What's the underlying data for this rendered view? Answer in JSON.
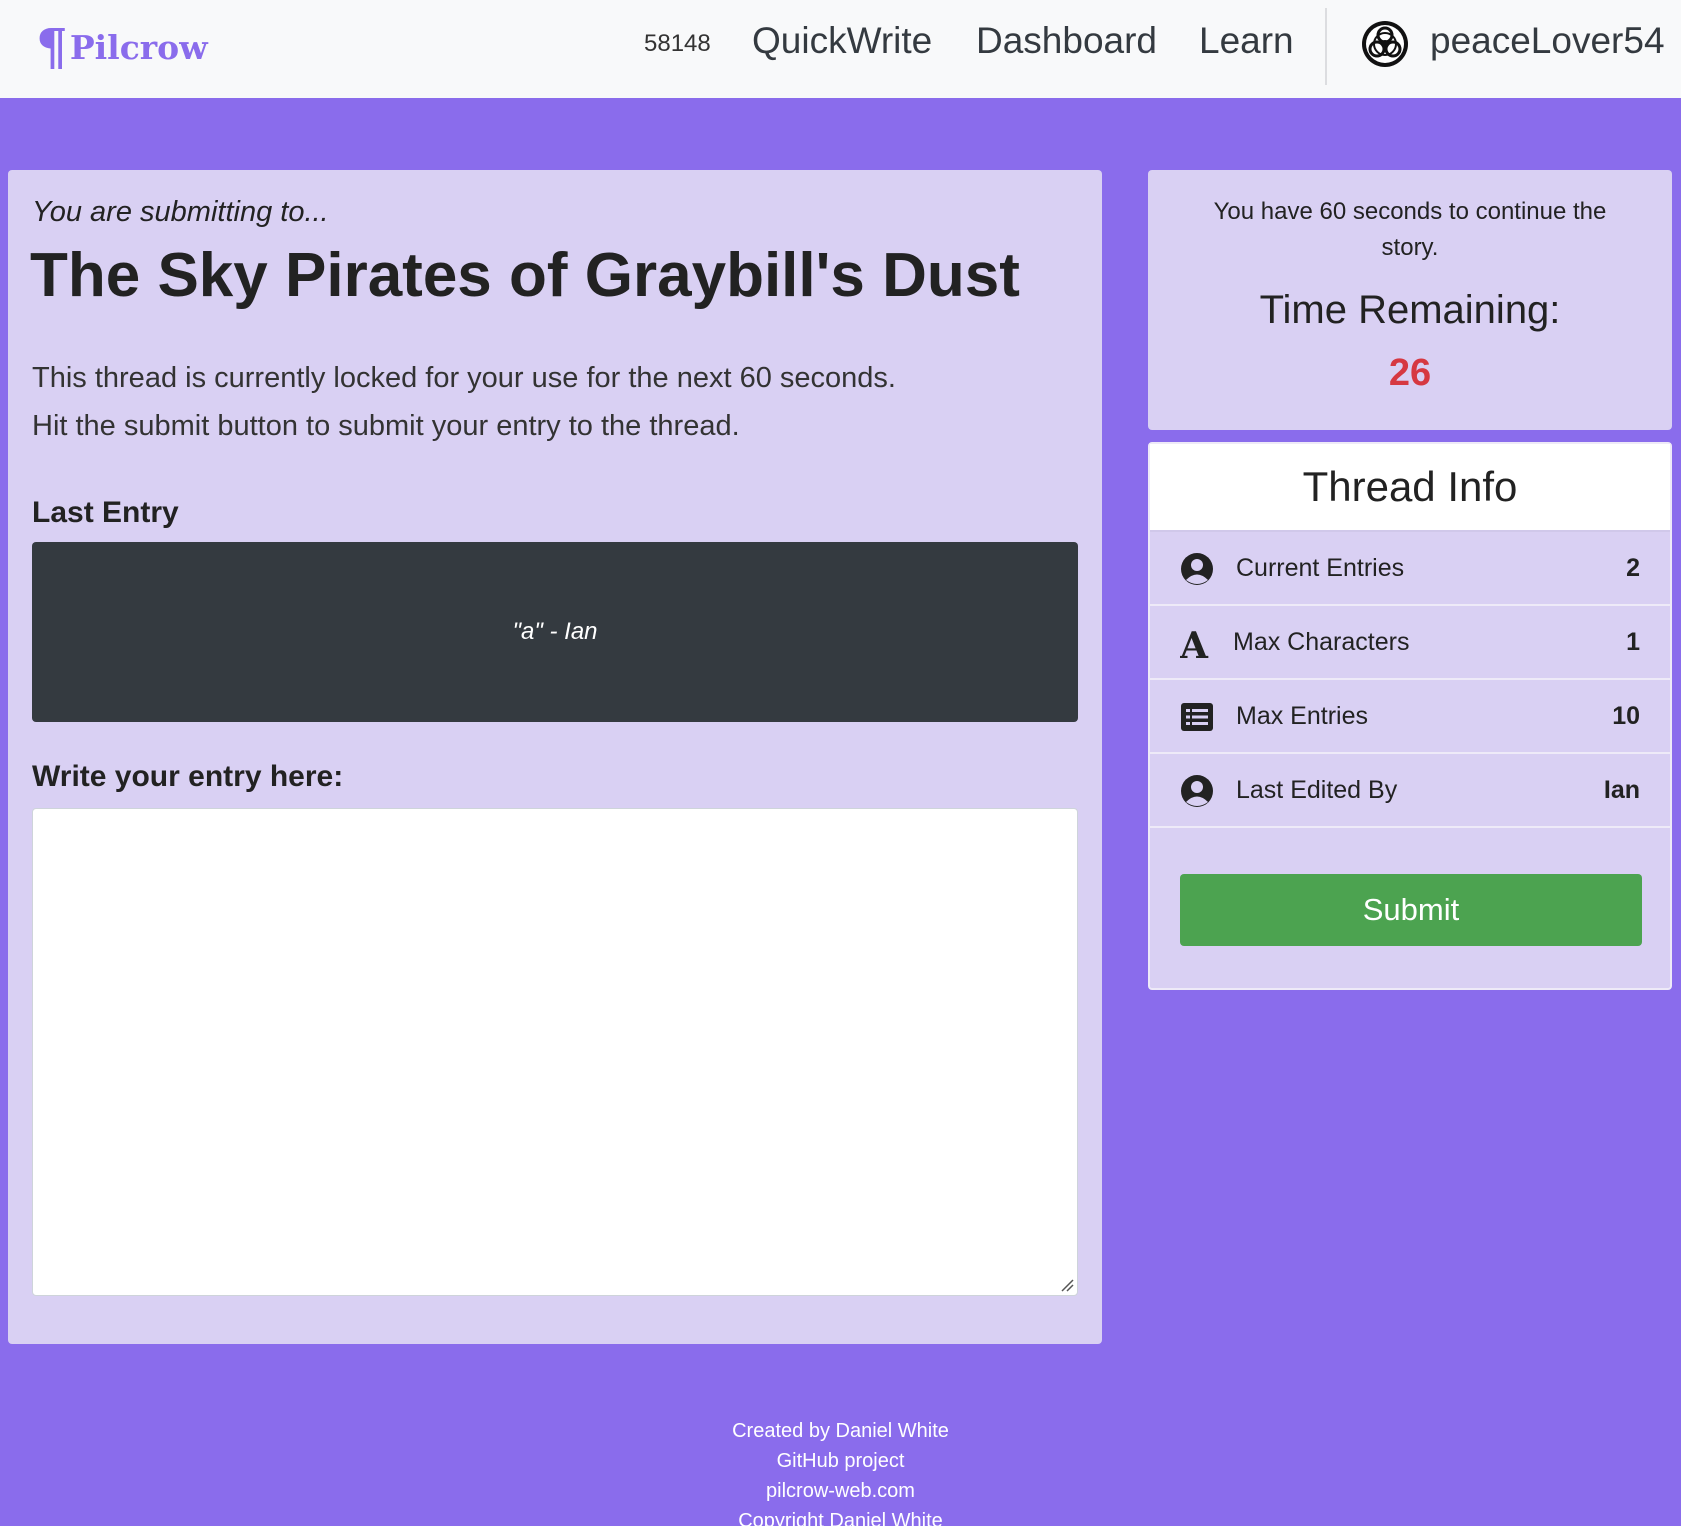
{
  "nav": {
    "brand": "Pilcrow",
    "brand_mark": "¶",
    "code": "58148",
    "links": [
      "QuickWrite",
      "Dashboard",
      "Learn"
    ],
    "username": "peaceLover54",
    "avatar_icon": "biohazard-icon"
  },
  "main": {
    "kicker": "You are submitting to...",
    "title": "The Sky Pirates of Graybill's Dust",
    "desc_line1": "This thread is currently locked for your use for the next 60 seconds.",
    "desc_line2": "Hit the submit button to submit your entry to the thread.",
    "last_entry_label": "Last Entry",
    "last_entry_text": "\"a\" - Ian",
    "write_label": "Write your entry here:",
    "entry_value": ""
  },
  "timer": {
    "message": "You have 60 seconds to continue the story.",
    "label": "Time Remaining:",
    "value": "26"
  },
  "thread_info": {
    "title": "Thread Info",
    "rows": [
      {
        "icon": "user-circle-icon",
        "label": "Current Entries",
        "value": "2"
      },
      {
        "icon": "font-a-icon",
        "label": "Max Characters",
        "value": "1"
      },
      {
        "icon": "list-icon",
        "label": "Max Entries",
        "value": "10"
      },
      {
        "icon": "user-circle-icon",
        "label": "Last Edited By",
        "value": "Ian"
      }
    ],
    "submit_label": "Submit"
  },
  "footer": {
    "lines": [
      "Created by Daniel White",
      "GitHub project",
      "pilcrow-web.com",
      "Copyright Daniel White"
    ]
  },
  "colors": {
    "background": "#8a6cec",
    "card": "#d9d0f3",
    "timer_value": "#d63841",
    "submit": "#4ca350",
    "entry_box": "#343a40"
  }
}
